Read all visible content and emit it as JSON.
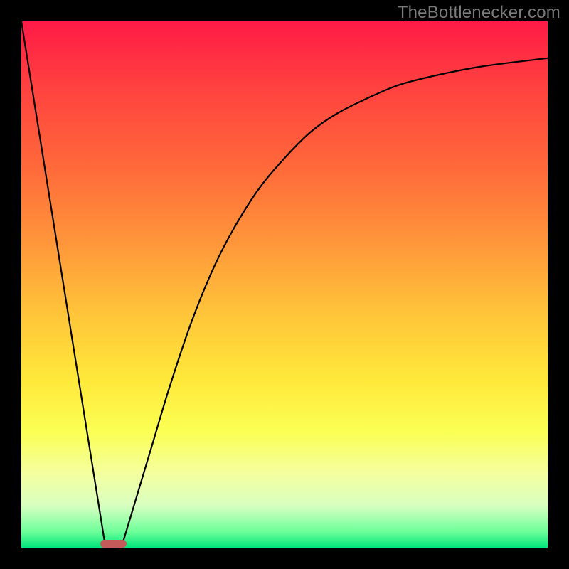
{
  "watermark": {
    "text": "TheBottlenecker.com"
  },
  "chart_data": {
    "type": "line",
    "title": "",
    "xlabel": "",
    "ylabel": "",
    "xlim": [
      0,
      100
    ],
    "ylim": [
      0,
      100
    ],
    "grid": false,
    "background_gradient": "vertical red→yellow→green",
    "series": [
      {
        "name": "left-v-branch",
        "x": [
          0,
          16
        ],
        "y": [
          100,
          0
        ]
      },
      {
        "name": "right-curve",
        "x": [
          19,
          22,
          25,
          28,
          32,
          36,
          40,
          45,
          50,
          55,
          60,
          66,
          72,
          80,
          88,
          100
        ],
        "y": [
          0,
          10,
          20,
          30,
          42,
          52,
          60,
          68,
          74,
          79,
          82.5,
          85.5,
          88,
          90,
          91.5,
          93
        ]
      }
    ],
    "marker": {
      "name": "min-point-marker",
      "x_range": [
        15,
        20
      ],
      "y": 0,
      "color": "#c45a5a"
    }
  }
}
